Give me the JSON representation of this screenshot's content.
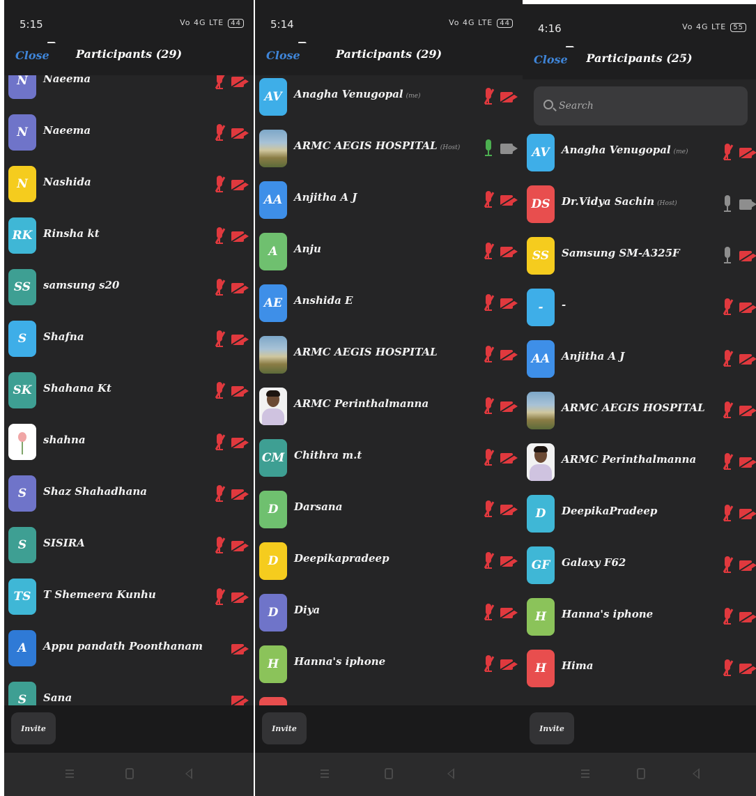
{
  "colors": {
    "background": "#252526",
    "header": "#1e1e1f",
    "close_link": "#3f85d8",
    "muted_red": "#e0393e",
    "mic_on_green": "#4caf50",
    "icon_gray": "#8e8e8e"
  },
  "panels": [
    {
      "status": {
        "time": "5:15",
        "signal": "Vo 4G LTE",
        "battery": "44"
      },
      "header": {
        "close": "Close",
        "title": "Participants (29)"
      },
      "invite": "Invite",
      "participants": [
        {
          "initials": "N",
          "name": "Naeema",
          "tag": "",
          "color": "#6f74c9",
          "mic": "muted",
          "cam": "muted"
        },
        {
          "initials": "N",
          "name": "Naeema",
          "tag": "",
          "color": "#6f74c9",
          "mic": "muted",
          "cam": "muted"
        },
        {
          "initials": "N",
          "name": "Nashida",
          "tag": "",
          "color": "#f5cc1e",
          "mic": "muted",
          "cam": "muted"
        },
        {
          "initials": "RK",
          "name": "Rinsha kt",
          "tag": "",
          "color": "#3fb7d6",
          "mic": "muted",
          "cam": "muted"
        },
        {
          "initials": "SS",
          "name": "samsung s20",
          "tag": "",
          "color": "#3e9f93",
          "mic": "muted",
          "cam": "muted"
        },
        {
          "initials": "S",
          "name": "Shafna",
          "tag": "",
          "color": "#3eaee8",
          "mic": "muted",
          "cam": "muted"
        },
        {
          "initials": "SK",
          "name": "Shahana Kt",
          "tag": "",
          "color": "#3e9f93",
          "mic": "muted",
          "cam": "muted"
        },
        {
          "initials": "",
          "name": "shahna",
          "tag": "",
          "color": "#ffffff",
          "photo": "flower",
          "mic": "muted",
          "cam": "muted"
        },
        {
          "initials": "S",
          "name": "Shaz Shahadhana",
          "tag": "",
          "color": "#6f74c9",
          "mic": "muted",
          "cam": "muted"
        },
        {
          "initials": "S",
          "name": "SISIRA",
          "tag": "",
          "color": "#3e9f93",
          "mic": "muted",
          "cam": "muted"
        },
        {
          "initials": "TS",
          "name": "T Shemeera Kunhu",
          "tag": "",
          "color": "#3fb7d6",
          "mic": "muted",
          "cam": "muted"
        },
        {
          "initials": "A",
          "name": "Appu pandath Poonthanam",
          "tag": "",
          "color": "#2f7ad6",
          "mic": "none",
          "cam": "muted"
        },
        {
          "initials": "S",
          "name": "Sana",
          "tag": "",
          "color": "#3e9f93",
          "mic": "none",
          "cam": "muted"
        }
      ]
    },
    {
      "status": {
        "time": "5:14",
        "signal": "Vo 4G LTE",
        "battery": "44"
      },
      "header": {
        "close": "Close",
        "title": "Participants (29)"
      },
      "invite": "Invite",
      "participants": [
        {
          "initials": "AV",
          "name": "Anagha Venugopal",
          "tag": "(me)",
          "color": "#3eaee8",
          "mic": "muted",
          "cam": "muted"
        },
        {
          "initials": "",
          "name": "ARMC AEGIS HOSPITAL",
          "tag": "(Host)",
          "color": "#9cb5c9",
          "photo": "building",
          "mic": "on",
          "cam": "off"
        },
        {
          "initials": "AA",
          "name": "Anjitha A J",
          "tag": "",
          "color": "#3e8fe8",
          "mic": "muted",
          "cam": "muted"
        },
        {
          "initials": "A",
          "name": "Anju",
          "tag": "",
          "color": "#6fc06f",
          "mic": "muted",
          "cam": "muted"
        },
        {
          "initials": "AE",
          "name": "Anshida E",
          "tag": "",
          "color": "#3e8fe8",
          "mic": "muted",
          "cam": "muted"
        },
        {
          "initials": "",
          "name": "ARMC AEGIS HOSPITAL",
          "tag": "",
          "color": "#9cb5c9",
          "photo": "building",
          "mic": "muted",
          "cam": "muted"
        },
        {
          "initials": "",
          "name": "ARMC Perinthalmanna",
          "tag": "",
          "color": "#f2f2f2",
          "photo": "man",
          "mic": "muted",
          "cam": "muted"
        },
        {
          "initials": "CM",
          "name": "Chithra m.t",
          "tag": "",
          "color": "#3e9f93",
          "mic": "muted",
          "cam": "muted"
        },
        {
          "initials": "D",
          "name": "Darsana",
          "tag": "",
          "color": "#6fc06f",
          "mic": "muted",
          "cam": "muted"
        },
        {
          "initials": "D",
          "name": "Deepikapradeep",
          "tag": "",
          "color": "#f5cc1e",
          "mic": "muted",
          "cam": "muted"
        },
        {
          "initials": "D",
          "name": "Diya",
          "tag": "",
          "color": "#6f74c9",
          "mic": "muted",
          "cam": "muted"
        },
        {
          "initials": "H",
          "name": "Hanna's iphone",
          "tag": "",
          "color": "#8bc35a",
          "mic": "muted",
          "cam": "muted"
        },
        {
          "initials": "",
          "name": "",
          "tag": "",
          "color": "#e84e4e",
          "mic": "muted",
          "cam": "muted"
        }
      ]
    },
    {
      "status": {
        "time": "4:16",
        "signal": "Vo 4G LTE",
        "battery": "55"
      },
      "header": {
        "close": "Close",
        "title": "Participants (25)"
      },
      "search": {
        "placeholder": "Search"
      },
      "invite": "Invite",
      "participants": [
        {
          "initials": "AV",
          "name": "Anagha Venugopal",
          "tag": "(me)",
          "color": "#3eaee8",
          "mic": "muted",
          "cam": "muted"
        },
        {
          "initials": "DS",
          "name": "Dr.Vidya Sachin",
          "tag": "(Host)",
          "color": "#e84e4e",
          "mic": "off",
          "cam": "off"
        },
        {
          "initials": "SS",
          "name": "Samsung SM-A325F",
          "tag": "",
          "color": "#f5cc1e",
          "mic": "off",
          "cam": "muted"
        },
        {
          "initials": "-",
          "name": "-",
          "tag": "",
          "color": "#3eaee8",
          "mic": "muted",
          "cam": "muted"
        },
        {
          "initials": "AA",
          "name": "Anjitha A J",
          "tag": "",
          "color": "#3e8fe8",
          "mic": "muted",
          "cam": "muted"
        },
        {
          "initials": "",
          "name": "ARMC AEGIS HOSPITAL",
          "tag": "",
          "color": "#9cb5c9",
          "photo": "building",
          "mic": "muted",
          "cam": "muted"
        },
        {
          "initials": "",
          "name": "ARMC Perinthalmanna",
          "tag": "",
          "color": "#f2f2f2",
          "photo": "man",
          "mic": "muted",
          "cam": "muted"
        },
        {
          "initials": "D",
          "name": "DeepikaPradeep",
          "tag": "",
          "color": "#3fb7d6",
          "mic": "muted",
          "cam": "muted"
        },
        {
          "initials": "GF",
          "name": "Galaxy F62",
          "tag": "",
          "color": "#3fb7d6",
          "mic": "muted",
          "cam": "muted"
        },
        {
          "initials": "H",
          "name": "Hanna's iphone",
          "tag": "",
          "color": "#8bc35a",
          "mic": "muted",
          "cam": "muted"
        },
        {
          "initials": "H",
          "name": "Hima",
          "tag": "",
          "color": "#e84e4e",
          "mic": "muted",
          "cam": "muted"
        }
      ]
    }
  ]
}
